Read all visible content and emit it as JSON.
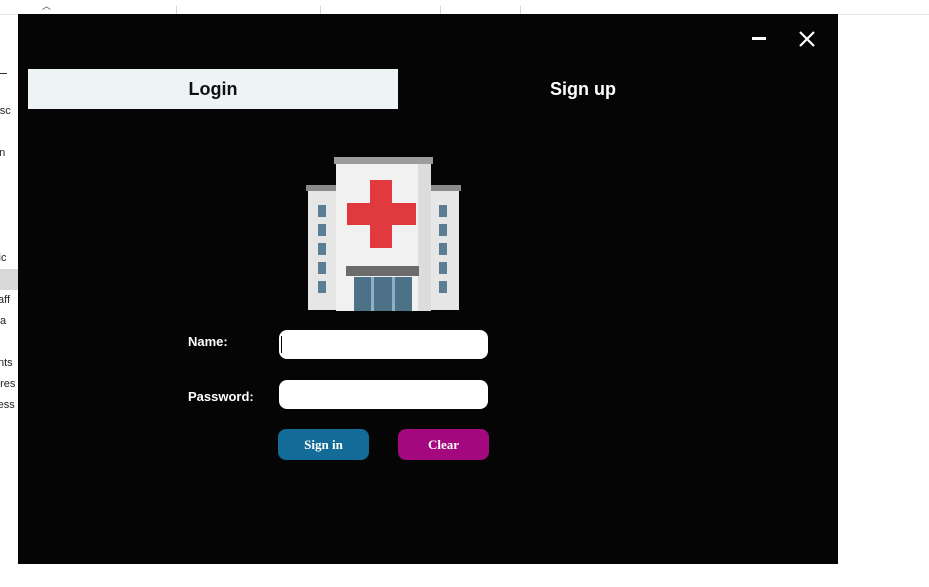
{
  "background_app": {
    "sidebar_fragments": [
      "n-sc",
      "ten",
      "t",
      "ctic",
      "aff",
      "a",
      "nts",
      "gres",
      "ress"
    ]
  },
  "window": {
    "minimize_symbol": "—",
    "close_symbol": "✕"
  },
  "tabs": {
    "login_label": "Login",
    "signup_label": "Sign up",
    "active": "login"
  },
  "logo": {
    "icon": "hospital-icon"
  },
  "form": {
    "name_label": "Name:",
    "name_value": "",
    "password_label": "Password:",
    "password_value": ""
  },
  "buttons": {
    "signin_label": "Sign in",
    "clear_label": "Clear"
  },
  "colors": {
    "dialog_bg": "#050505",
    "active_tab_bg": "#eef3f6",
    "signin_bg": "#136c98",
    "clear_bg": "#a3087e",
    "cross_red": "#e03a3e"
  }
}
